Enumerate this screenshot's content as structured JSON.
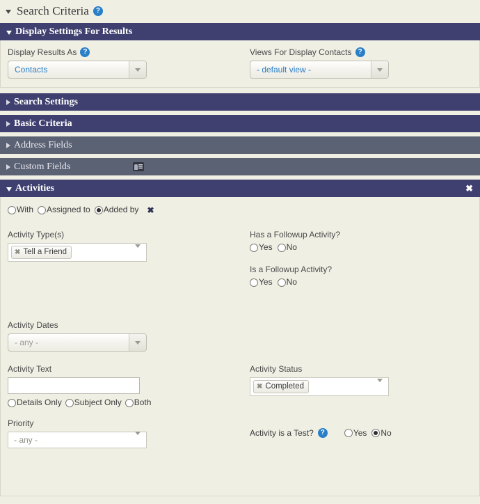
{
  "colors": {
    "accent_navy": "#3f4070",
    "muted_slate": "#5a6273",
    "page_bg": "#f0efe4",
    "link_blue": "#2a7fc9",
    "help_blue": "#2a7fc9"
  },
  "search_criteria": {
    "title": "Search Criteria",
    "help_icon": "help-circle-icon",
    "caret": "caret-down-icon"
  },
  "sections": {
    "display_settings": {
      "title": "Display Settings For Results",
      "expanded": true,
      "fields": {
        "display_results_as": {
          "label": "Display Results As",
          "help_icon": "help-circle-icon",
          "value": "Contacts",
          "arrow_icon": "chevron-down-icon"
        },
        "views_for_display": {
          "label": "Views For Display Contacts",
          "help_icon": "help-circle-icon",
          "value": "- default view -",
          "arrow_icon": "chevron-down-icon"
        }
      }
    },
    "search_settings": {
      "title": "Search Settings",
      "expanded": false,
      "style": "active"
    },
    "basic_criteria": {
      "title": "Basic Criteria",
      "expanded": false,
      "style": "active"
    },
    "address_fields": {
      "title": "Address Fields",
      "expanded": false,
      "style": "muted"
    },
    "custom_fields": {
      "title": "Custom Fields",
      "expanded": false,
      "style": "muted",
      "icon": "contact-card-icon"
    },
    "activities": {
      "title": "Activities",
      "expanded": true,
      "close_icon": "close-icon",
      "contact_role": {
        "options": [
          {
            "label": "With",
            "selected": false
          },
          {
            "label": "Assigned to",
            "selected": false
          },
          {
            "label": "Added by",
            "selected": true
          }
        ],
        "remove_icon": "remove-x-icon"
      },
      "activity_types": {
        "label": "Activity Type(s)",
        "tokens": [
          {
            "label": "Tell a Friend",
            "remove_icon": "token-remove-icon"
          }
        ],
        "arrow_icon": "chevron-down-icon"
      },
      "has_followup": {
        "label": "Has a Followup Activity?",
        "options": [
          {
            "label": "Yes",
            "selected": false
          },
          {
            "label": "No",
            "selected": false
          }
        ]
      },
      "is_followup": {
        "label": "Is a Followup Activity?",
        "options": [
          {
            "label": "Yes",
            "selected": false
          },
          {
            "label": "No",
            "selected": false
          }
        ]
      },
      "activity_dates": {
        "label": "Activity Dates",
        "value": "- any -",
        "is_placeholder": true,
        "arrow_icon": "chevron-down-icon"
      },
      "activity_text": {
        "label": "Activity Text",
        "value": "",
        "placeholder": "",
        "scope_options": [
          {
            "label": "Details Only",
            "selected": false
          },
          {
            "label": "Subject Only",
            "selected": false
          },
          {
            "label": "Both",
            "selected": false
          }
        ]
      },
      "activity_status": {
        "label": "Activity Status",
        "tokens": [
          {
            "label": "Completed",
            "remove_icon": "token-remove-icon"
          }
        ],
        "arrow_icon": "chevron-down-icon"
      },
      "priority": {
        "label": "Priority",
        "value": "- any -",
        "is_placeholder": true,
        "arrow_icon": "chevron-down-icon"
      },
      "activity_is_test": {
        "label": "Activity is a Test?",
        "help_icon": "help-circle-icon",
        "options": [
          {
            "label": "Yes",
            "selected": false
          },
          {
            "label": "No",
            "selected": true
          }
        ]
      }
    }
  }
}
